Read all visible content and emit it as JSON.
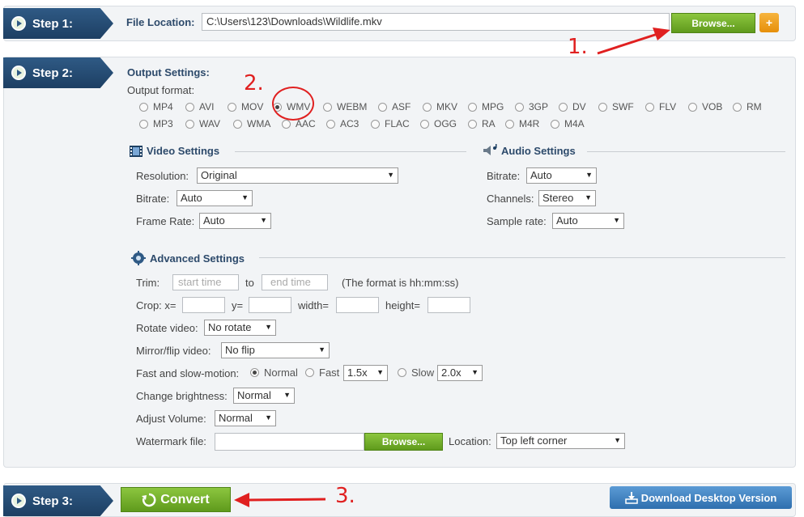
{
  "step1": {
    "tab": "Step 1:",
    "file_location_label": "File Location:",
    "file_path": "C:\\Users\\123\\Downloads\\Wildlife.mkv",
    "browse_label": "Browse...",
    "add_label": "+"
  },
  "step2": {
    "tab": "Step 2:",
    "output_settings": "Output Settings:",
    "output_format": "Output format:",
    "formats_row1": [
      "MP4",
      "AVI",
      "MOV",
      "WMV",
      "WEBM",
      "ASF",
      "MKV",
      "MPG",
      "3GP",
      "DV",
      "SWF",
      "FLV",
      "VOB",
      "RM"
    ],
    "formats_row2": [
      "MP3",
      "WAV",
      "WMA",
      "AAC",
      "AC3",
      "FLAC",
      "OGG",
      "RA",
      "M4R",
      "M4A"
    ],
    "selected_format": "WMV",
    "video": {
      "title": "Video Settings",
      "resolution_label": "Resolution:",
      "resolution_value": "Original",
      "bitrate_label": "Bitrate:",
      "bitrate_value": "Auto",
      "framerate_label": "Frame Rate:",
      "framerate_value": "Auto"
    },
    "audio": {
      "title": "Audio Settings",
      "bitrate_label": "Bitrate:",
      "bitrate_value": "Auto",
      "channels_label": "Channels:",
      "channels_value": "Stereo",
      "samplerate_label": "Sample rate:",
      "samplerate_value": "Auto"
    },
    "advanced": {
      "title": "Advanced Settings",
      "trim_label": "Trim:",
      "start_placeholder": "start time",
      "to_label": "to",
      "end_placeholder": "end time",
      "trim_hint": "(The format is hh:mm:ss)",
      "crop_label": "Crop: x=",
      "crop_y": "y=",
      "crop_width": "width=",
      "crop_height": "height=",
      "rotate_label": "Rotate video:",
      "rotate_value": "No rotate",
      "mirror_label": "Mirror/flip video:",
      "mirror_value": "No flip",
      "speed_label": "Fast and slow-motion:",
      "speed_normal": "Normal",
      "speed_fast": "Fast",
      "speed_fast_value": "1.5x",
      "speed_slow": "Slow",
      "speed_slow_value": "2.0x",
      "brightness_label": "Change brightness:",
      "brightness_value": "Normal",
      "volume_label": "Adjust Volume:",
      "volume_value": "Normal",
      "watermark_label": "Watermark file:",
      "watermark_browse": "Browse...",
      "location_label": "Location:",
      "location_value": "Top left corner"
    }
  },
  "step3": {
    "tab": "Step 3:",
    "convert_label": "Convert",
    "download_label": "Download Desktop Version"
  },
  "annotations": {
    "n1": "1.",
    "n2": "2.",
    "n3": "3."
  },
  "colors": {
    "step_tab": "#1d3f63",
    "green_button": "#6fae24",
    "orange_button": "#f0a020",
    "annotation_red": "#e02020"
  }
}
